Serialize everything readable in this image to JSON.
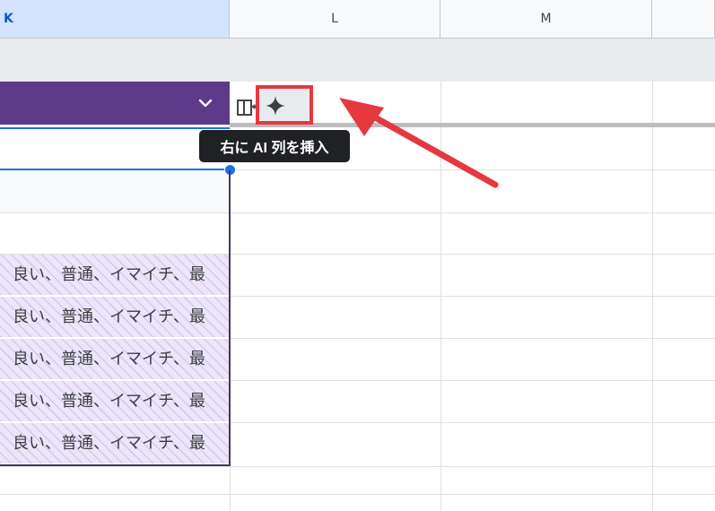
{
  "columns": [
    {
      "id": "K",
      "label": "K",
      "selected": true
    },
    {
      "id": "L",
      "label": "L",
      "selected": false
    },
    {
      "id": "M",
      "label": "M",
      "selected": false
    }
  ],
  "table": {
    "header_color": "#5e3b8a",
    "dropdown_icon": "chevron-down-icon",
    "chip_cells": [
      "良い、普通、イマイチ、最",
      "良い、普通、イマイチ、最",
      "良い、普通、イマイチ、最",
      "良い、普通、イマイチ、最",
      "良い、普通、イマイチ、最"
    ]
  },
  "toolbar": {
    "insert_column_icon": "insert-column-icon",
    "ai_icon": "sparkle-icon"
  },
  "tooltip": {
    "text": "右に AI 列を挿入"
  },
  "annotation": {
    "highlight_color": "#e5383f",
    "arrow_color": "#e5383f"
  }
}
